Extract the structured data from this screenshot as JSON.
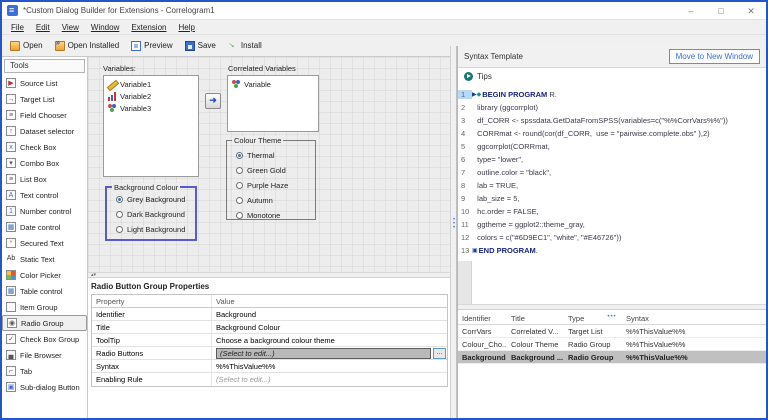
{
  "window": {
    "title": "*Custom Dialog Builder for Extensions - Correlogram1",
    "controls": [
      {
        "name": "minimize-button",
        "glyph": "–"
      },
      {
        "name": "maximize-button",
        "glyph": "□"
      },
      {
        "name": "close-button",
        "glyph": "✕"
      }
    ]
  },
  "menu": {
    "items": [
      "File",
      "Edit",
      "View",
      "Window",
      "Extension",
      "Help"
    ]
  },
  "toolbar": {
    "buttons": [
      {
        "label": "Open",
        "icon": "open-icon"
      },
      {
        "label": "Open Installed",
        "icon": "open-installed-icon"
      },
      {
        "label": "Preview",
        "icon": "preview-icon"
      },
      {
        "label": "Save",
        "icon": "save-icon"
      },
      {
        "label": "Install",
        "icon": "install-icon"
      }
    ]
  },
  "tools": {
    "header": "Tools",
    "items": [
      {
        "label": "Source List",
        "icon": "source-list-icon",
        "glyph": "▶",
        "color": "#c03030",
        "boxed": true
      },
      {
        "label": "Target List",
        "icon": "target-list-icon",
        "glyph": "→",
        "color": "#c03030",
        "boxed": true
      },
      {
        "label": "Field Chooser",
        "icon": "field-chooser-icon",
        "glyph": "≡",
        "color": "#555555",
        "boxed": true
      },
      {
        "label": "Dataset selector",
        "icon": "dataset-selector-icon",
        "glyph": "↑",
        "color": "#c03030",
        "boxed": true
      },
      {
        "label": "Check Box",
        "icon": "check-box-icon",
        "glyph": "x",
        "color": "#3b6fd4",
        "boxed": true
      },
      {
        "label": "Combo Box",
        "icon": "combo-box-icon",
        "glyph": "▾",
        "color": "#555555",
        "boxed": true
      },
      {
        "label": "List Box",
        "icon": "list-box-icon",
        "glyph": "≡",
        "color": "#555555",
        "boxed": true
      },
      {
        "label": "Text control",
        "icon": "text-control-icon",
        "glyph": "A",
        "color": "#3b6fd4",
        "boxed": true
      },
      {
        "label": "Number control",
        "icon": "number-control-icon",
        "glyph": "1",
        "color": "#3b6fd4",
        "boxed": true
      },
      {
        "label": "Date control",
        "icon": "date-control-icon",
        "glyph": "▦",
        "color": "#3b6fd4",
        "boxed": true
      },
      {
        "label": "Secured Text",
        "icon": "secured-text-icon",
        "glyph": "*",
        "color": "#b8860b",
        "boxed": true
      },
      {
        "label": "Static Text",
        "icon": "static-text-icon",
        "glyph": "Ab",
        "color": "#333333",
        "boxed": false
      },
      {
        "label": "Color Picker",
        "icon": "color-picker-icon",
        "glyph": "",
        "color": "#333333",
        "boxed": true,
        "special": "palette"
      },
      {
        "label": "Table control",
        "icon": "table-control-icon",
        "glyph": "▦",
        "color": "#3b6fd4",
        "boxed": true
      },
      {
        "label": "Item Group",
        "icon": "item-group-icon",
        "glyph": "",
        "color": "#555555",
        "boxed": true
      },
      {
        "label": "Radio Group",
        "icon": "radio-group-icon",
        "glyph": "◉",
        "color": "#555555",
        "boxed": true,
        "selected": true
      },
      {
        "label": "Check Box Group",
        "icon": "check-box-group-icon",
        "glyph": "✓",
        "color": "#555555",
        "boxed": true
      },
      {
        "label": "File Browser",
        "icon": "file-browser-icon",
        "glyph": "▄",
        "color": "#555555",
        "boxed": true
      },
      {
        "label": "Tab",
        "icon": "tab-icon",
        "glyph": "⌐",
        "color": "#555555",
        "boxed": true
      },
      {
        "label": "Sub-dialog Button",
        "icon": "sub-dialog-button-icon",
        "glyph": "▣",
        "color": "#3b6fd4",
        "boxed": true
      }
    ]
  },
  "canvas": {
    "variables": {
      "label": "Variables:",
      "items": [
        {
          "name": "Variable1",
          "measure": "scale"
        },
        {
          "name": "Variable2",
          "measure": "ordinal"
        },
        {
          "name": "Variable3",
          "measure": "nominal"
        }
      ]
    },
    "correlated": {
      "label": "Correlated Variables",
      "items": [
        {
          "name": "Variable",
          "measure": "nominal"
        }
      ]
    },
    "colour_theme": {
      "title": "Colour Theme",
      "options": [
        "Thermal",
        "Green Gold",
        "Purple Haze",
        "Autumn",
        "Monotone"
      ],
      "selected": 0
    },
    "background_colour": {
      "title": "Background Colour",
      "options": [
        "Grey Background",
        "Dark Background",
        "Light Background"
      ],
      "selected": 0
    }
  },
  "properties": {
    "title": "Radio Button Group Properties",
    "columns": [
      "Property",
      "Value"
    ],
    "edit_button_label": "...",
    "rows": [
      {
        "property": "Identifier",
        "value": "Background"
      },
      {
        "property": "Title",
        "value": "Background Colour"
      },
      {
        "property": "ToolTip",
        "value": "Choose a background colour theme"
      },
      {
        "property": "Radio Buttons",
        "value": "(Select to edit...)",
        "selected": true,
        "editable": true
      },
      {
        "property": "Syntax",
        "value": "%%ThisValue%%"
      },
      {
        "property": "Enabling Rule",
        "value": "(Select to edit...)",
        "muted": true
      }
    ]
  },
  "syntax_panel": {
    "title": "Syntax Template",
    "move_button": "Move to New Window",
    "tips_label": "Tips",
    "code": [
      {
        "n": 1,
        "markers": [
          "play",
          "breakpoint"
        ],
        "keyword": "BEGIN PROGRAM",
        "text": " R."
      },
      {
        "n": 2,
        "text": "  library (ggcorrplot)"
      },
      {
        "n": 3,
        "text": "  df_CORR <- spssdata.GetDataFromSPSS(variables=c(\"%%CorrVars%%\"))"
      },
      {
        "n": 4,
        "text": "  CORRmat <- round(cor(df_CORR,  use = \"pairwise.complete.obs\" ),2)"
      },
      {
        "n": 5,
        "text": "  ggcorrplot(CORRmat,"
      },
      {
        "n": 6,
        "text": "  type= \"lower\","
      },
      {
        "n": 7,
        "text": "  outline.color = \"black\","
      },
      {
        "n": 8,
        "text": "  lab = TRUE,"
      },
      {
        "n": 9,
        "text": "  lab_size = 5,"
      },
      {
        "n": 10,
        "text": "  hc.order = FALSE,"
      },
      {
        "n": 11,
        "text": "  ggtheme = ggplot2::theme_gray,"
      },
      {
        "n": 12,
        "text": "  colors = c(\"#6D9EC1\", \"white\", \"#E46726\"))"
      },
      {
        "n": 13,
        "markers": [
          "end-block"
        ],
        "keyword": "END PROGRAM",
        "text": "."
      }
    ],
    "params_table": {
      "columns": [
        "Identifier",
        "Title",
        "Type",
        "Syntax"
      ],
      "rows": [
        [
          "CorrVars",
          "Correlated V...",
          "Target List",
          "%%ThisValue%%"
        ],
        [
          "Colour_Cho...",
          "Colour Theme",
          "Radio Group",
          "%%ThisValue%%"
        ],
        [
          "Background",
          "Background ...",
          "Radio Group",
          "%%ThisValue%%"
        ]
      ],
      "selected_row": 2
    }
  },
  "colors": {
    "window_border": "#2456c9",
    "accent_blue": "#3b6fd4",
    "keyword_navy": "#1a237e",
    "selection_gray": "#b9b9b9",
    "splitter_dots": "#4b79d8",
    "canvas_background": "#ededed",
    "code_palette_values": [
      "#6D9EC1",
      "#E46726"
    ]
  }
}
